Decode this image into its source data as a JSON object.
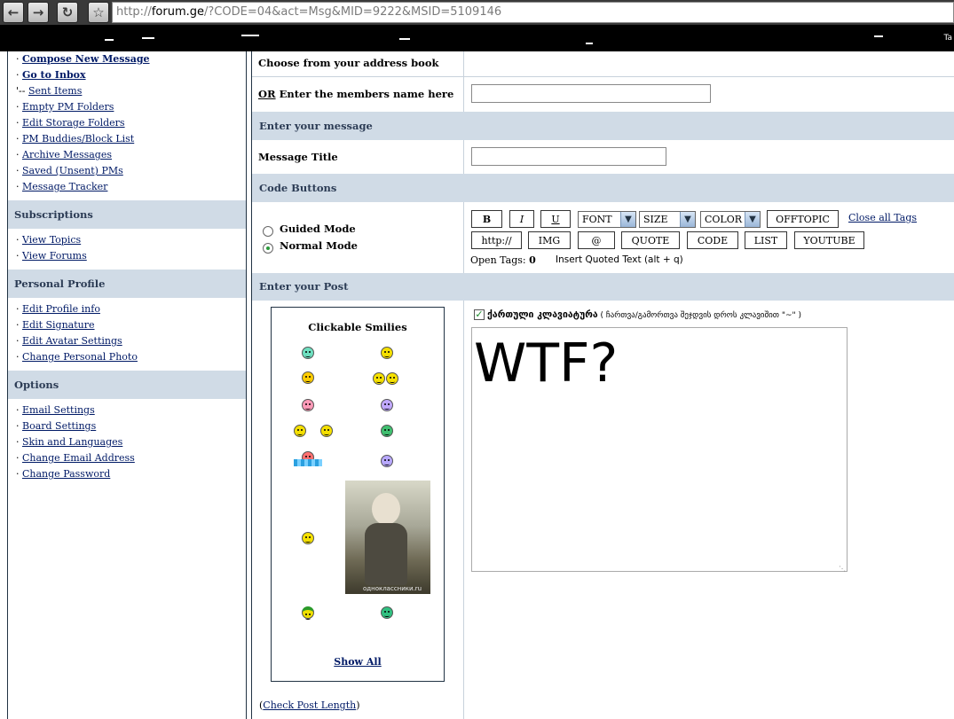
{
  "browser": {
    "url_prefix": "http://",
    "url_host": "forum.ge",
    "url_rest": "/?CODE=04&act=Msg&MID=9222&MSID=5109146",
    "top_right_text": "Ta"
  },
  "sidebar": {
    "items": [
      {
        "prefix": "· ",
        "label": "Compose New Message",
        "bold": true
      },
      {
        "prefix": "· ",
        "label": "Go to Inbox",
        "bold": true
      },
      {
        "prefix": "'-- ",
        "label": "Sent Items"
      },
      {
        "prefix": "· ",
        "label": "Empty PM Folders"
      },
      {
        "prefix": "· ",
        "label": "Edit Storage Folders"
      },
      {
        "prefix": "· ",
        "label": "PM Buddies/Block List"
      },
      {
        "prefix": "· ",
        "label": "Archive Messages"
      },
      {
        "prefix": "· ",
        "label": "Saved (Unsent) PMs"
      },
      {
        "prefix": "· ",
        "label": "Message Tracker"
      }
    ],
    "subscriptions_title": "Subscriptions",
    "subscriptions": [
      {
        "prefix": "· ",
        "label": "View Topics"
      },
      {
        "prefix": "· ",
        "label": "View Forums"
      }
    ],
    "profile_title": "Personal Profile",
    "profile": [
      {
        "prefix": "· ",
        "label": "Edit Profile info"
      },
      {
        "prefix": "· ",
        "label": "Edit Signature"
      },
      {
        "prefix": "· ",
        "label": "Edit Avatar Settings"
      },
      {
        "prefix": "· ",
        "label": "Change Personal Photo"
      }
    ],
    "options_title": "Options",
    "options": [
      {
        "prefix": "· ",
        "label": "Email Settings"
      },
      {
        "prefix": "· ",
        "label": "Board Settings"
      },
      {
        "prefix": "· ",
        "label": "Skin and Languages"
      },
      {
        "prefix": "· ",
        "label": "Change Email Address"
      },
      {
        "prefix": "· ",
        "label": "Change Password"
      }
    ]
  },
  "form": {
    "address_book_label": "Choose from your address book",
    "or_label": "OR",
    "member_name_label": " Enter the members name here",
    "member_name_value": "",
    "enter_message_head": "Enter your message",
    "message_title_label": "Message Title",
    "message_title_value": "",
    "code_buttons_head": "Code Buttons",
    "guided_mode": "Guided Mode",
    "normal_mode": "Normal Mode",
    "buttons_row1": {
      "bold": "B",
      "italic": "I",
      "underline": "U",
      "font": "FONT",
      "size": "SIZE",
      "color": "COLOR",
      "offtopic": "OFFTOPIC",
      "close_tags": "Close all Tags"
    },
    "buttons_row2": {
      "http": "http://",
      "img": "IMG",
      "at": "@",
      "quote": "QUOTE",
      "code": "CODE",
      "list": "LIST",
      "youtube": "YOUTUBE"
    },
    "open_tags_label": "Open Tags:",
    "open_tags_count": "0",
    "insert_quoted": "Insert Quoted Text (alt + q)",
    "enter_post_head": "Enter your Post",
    "smilies_title": "Clickable Smilies",
    "photo_caption": "одноклассники.ru",
    "show_all": "Show All",
    "georgian_kb_label": "ქართული კლავიატურა",
    "georgian_kb_hint": " ( ჩართვა/გამორთვა შეჯდვის დროს კლავიშით \"~\" )",
    "post_text": "WTF?",
    "check_length_open": "(",
    "check_length": "Check Post Length",
    "check_length_close": ")"
  }
}
